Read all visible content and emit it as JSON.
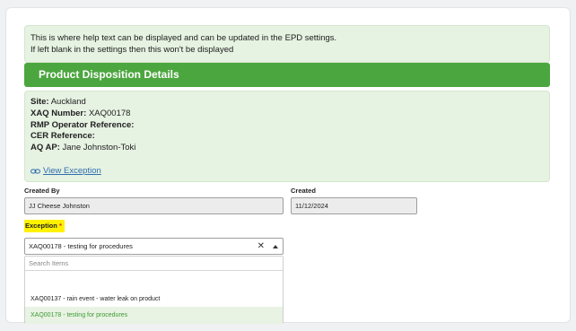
{
  "help": {
    "line1": "This is where help text can be displayed and can be updated in the EPD settings.",
    "line2": "If left blank in the settings then this won't be displayed"
  },
  "banner": {
    "title": "Product Disposition Details"
  },
  "details": {
    "site_label": "Site:",
    "site_value": "Auckland",
    "xaq_label": "XAQ Number:",
    "xaq_value": "XAQ00178",
    "rmp_label": "RMP Operator Reference:",
    "rmp_value": "",
    "cer_label": "CER Reference:",
    "cer_value": "",
    "aqap_label": "AQ AP:",
    "aqap_value": "Jane Johnston-Toki",
    "view_link": "View Exception"
  },
  "form": {
    "created_by_label": "Created By",
    "created_by_value": "JJ Cheese Johnston",
    "created_label": "Created",
    "created_value": "11/12/2024",
    "exception_label": "Exception",
    "exception_required": "*",
    "exception_value": "XAQ00178 - testing for procedures",
    "search_placeholder": "Search Items",
    "options": [
      "XAQ00137 - rain event - water leak on product",
      "XAQ00178 - testing for procedures"
    ]
  },
  "colors": {
    "banner": "#4ca63f",
    "panel": "#e6f2e2",
    "highlight": "#fff200",
    "selected_option_text": "#3d9a35",
    "link": "#2f6fae"
  },
  "icons": {
    "view_link_icon": "link-icon",
    "clear_icon": "close-icon",
    "dropdown_icon": "caret-up-icon"
  }
}
